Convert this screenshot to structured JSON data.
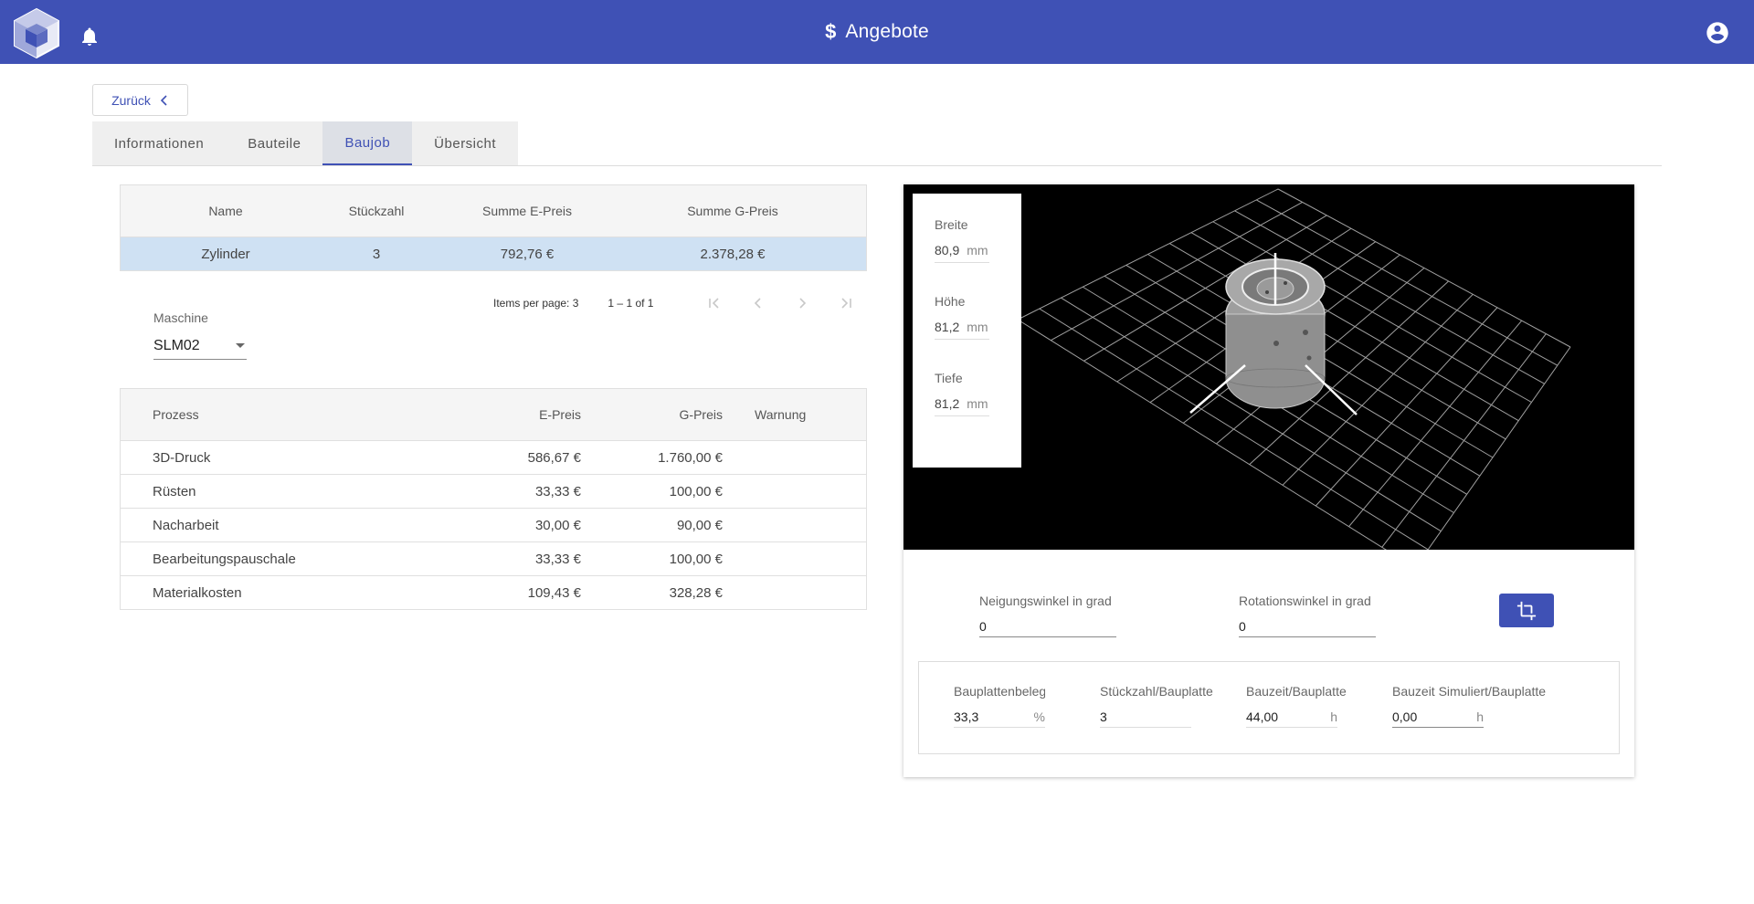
{
  "header": {
    "title": "Angebote",
    "title_icon": "dollar-icon",
    "dollar": "$",
    "colors": {
      "primary": "#3f51b5"
    }
  },
  "back_button": {
    "label": "Zurück"
  },
  "tabs": [
    {
      "label": "Informationen",
      "active": false
    },
    {
      "label": "Bauteile",
      "active": false
    },
    {
      "label": "Baujob",
      "active": true
    },
    {
      "label": "Übersicht",
      "active": false
    }
  ],
  "parts_table": {
    "headers": [
      "Name",
      "Stückzahl",
      "Summe E-Preis",
      "Summe G-Preis"
    ],
    "rows": [
      {
        "name": "Zylinder",
        "qty": "3",
        "sum_e": "792,76 €",
        "sum_g": "2.378,28 €"
      }
    ]
  },
  "paginator": {
    "items_per_page_label": "Items per page:",
    "items_per_page": "3",
    "range": "1 – 1 of 1"
  },
  "machine": {
    "label": "Maschine",
    "value": "SLM02"
  },
  "process_table": {
    "headers": [
      "Prozess",
      "E-Preis",
      "G-Preis",
      "Warnung"
    ],
    "rows": [
      {
        "process": "3D-Druck",
        "e": "586,67 €",
        "g": "1.760,00 €",
        "warn": ""
      },
      {
        "process": "Rüsten",
        "e": "33,33 €",
        "g": "100,00 €",
        "warn": ""
      },
      {
        "process": "Nacharbeit",
        "e": "30,00 €",
        "g": "90,00 €",
        "warn": ""
      },
      {
        "process": "Bearbeitungspauschale",
        "e": "33,33 €",
        "g": "100,00 €",
        "warn": ""
      },
      {
        "process": "Materialkosten",
        "e": "109,43 €",
        "g": "328,28 €",
        "warn": ""
      }
    ]
  },
  "dimensions": {
    "breite": {
      "label": "Breite",
      "value": "80,9",
      "unit": "mm"
    },
    "hoehe": {
      "label": "Höhe",
      "value": "81,2",
      "unit": "mm"
    },
    "tiefe": {
      "label": "Tiefe",
      "value": "81,2",
      "unit": "mm"
    }
  },
  "orientation": {
    "neigung": {
      "label": "Neigungswinkel in grad",
      "value": "0"
    },
    "rotation": {
      "label": "Rotationswinkel in grad",
      "value": "0"
    }
  },
  "bauplatte": {
    "belegung": {
      "label": "Bauplattenbelegung",
      "value": "33,3",
      "unit": "%"
    },
    "stueckzahl": {
      "label": "Stückzahl/Bauplatte",
      "value": "3",
      "unit": ""
    },
    "bauzeit": {
      "label": "Bauzeit/Bauplatte",
      "value": "44,00",
      "unit": "h"
    },
    "bauzeit_sim": {
      "label": "Bauzeit Simuliert/Bauplatte",
      "value": "0,00",
      "unit": "h"
    }
  }
}
